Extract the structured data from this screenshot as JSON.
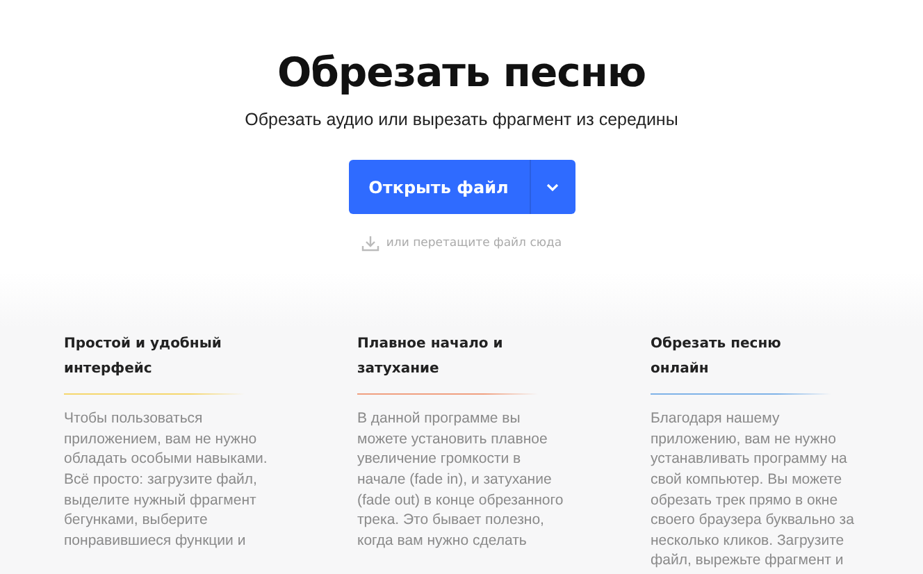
{
  "header": {
    "title": "Обрезать песню",
    "subtitle": "Обрезать аудио или вырезать фрагмент из середины"
  },
  "open_button": {
    "label": "Открыть файл",
    "menu_caret": true
  },
  "drop_hint": "или перетащите файл сюда",
  "features": [
    {
      "title": "Простой и удобный интерфейс",
      "color": "#f5d76e",
      "lines": [
        "Чтобы пользоваться",
        "приложением, вам не нужно",
        "обладать особыми навыками.",
        "Всё просто: загрузите файл,",
        "выделите нужный фрагмент",
        "бегунками, выберите",
        "понравившиеся функции и"
      ]
    },
    {
      "title": "Плавное начало и затухание",
      "color": "#f0a080",
      "lines": [
        "В данной программе вы",
        "можете установить плавное",
        "увеличение громкости в",
        "начале (fade in), и затухание",
        "(fade out) в конце обрезанного",
        "трека. Это бывает полезно,",
        "когда вам нужно сделать"
      ]
    },
    {
      "title": "Обрезать песню онлайн",
      "color": "#7fb3e8",
      "lines": [
        "Благодаря нашему",
        "приложению, вам не нужно",
        "устанавливать программу на",
        "свой компьютер. Вы можете",
        "обрезать трек прямо в окне",
        "своего браузера буквально за",
        "несколько кликов. Загрузите",
        "файл, вырежьте фрагмент и"
      ]
    }
  ]
}
